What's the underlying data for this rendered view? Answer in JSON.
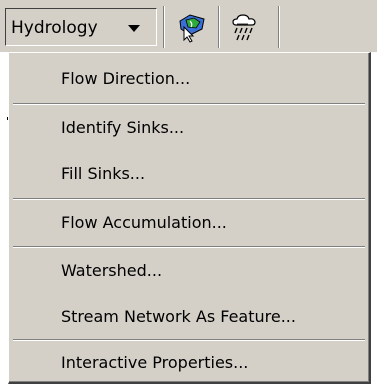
{
  "toolbar": {
    "menu_label": "Hydrology",
    "buttons": [
      {
        "icon": "flow-tool-icon"
      },
      {
        "icon": "rain-cloud-icon"
      }
    ]
  },
  "menu": {
    "items": [
      {
        "label": "Flow Direction..."
      },
      {
        "label": "Identify Sinks..."
      },
      {
        "label": "Fill Sinks..."
      },
      {
        "label": "Flow Accumulation..."
      },
      {
        "label": "Watershed..."
      },
      {
        "label": "Stream Network As Feature..."
      },
      {
        "label": "Interactive Properties..."
      }
    ]
  }
}
